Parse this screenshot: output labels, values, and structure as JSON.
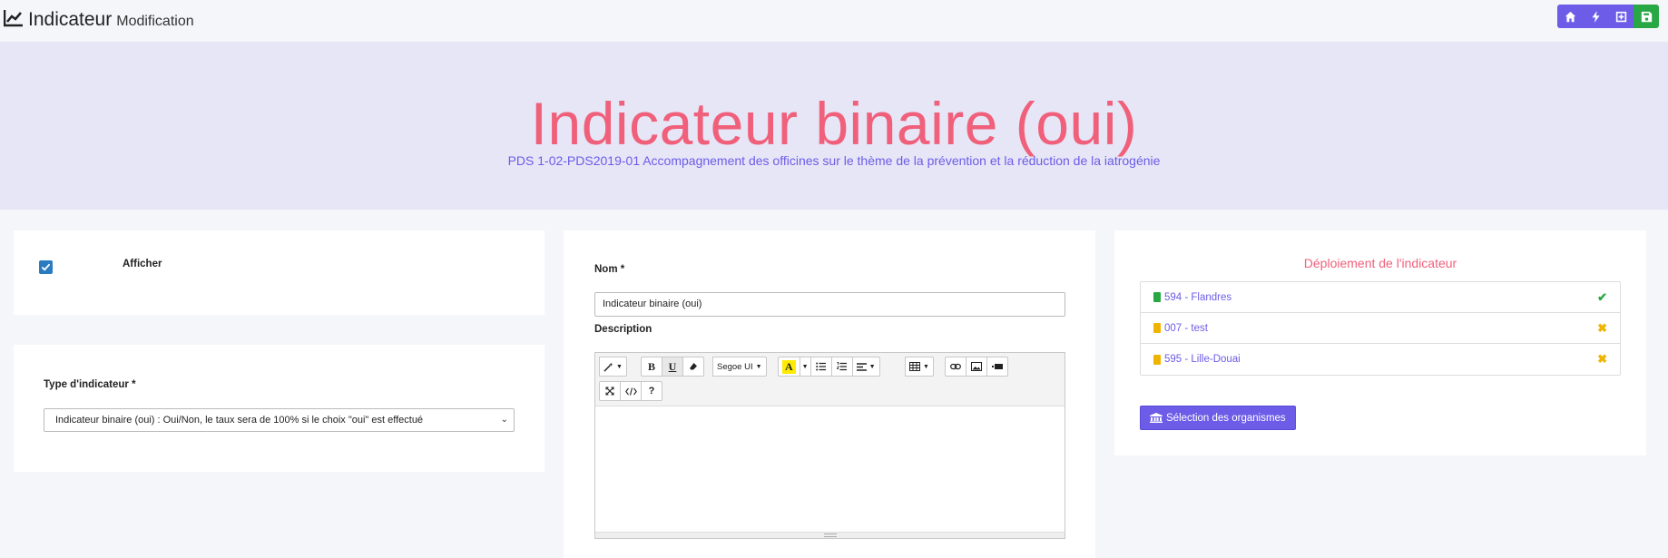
{
  "header": {
    "title": "Indicateur",
    "subtitle": "Modification",
    "actions": [
      {
        "icon": "home-icon"
      },
      {
        "icon": "bolt-icon"
      },
      {
        "icon": "plus-square-icon"
      },
      {
        "icon": "save-icon"
      }
    ]
  },
  "hero": {
    "title": "Indicateur binaire (oui)",
    "subtitle": "PDS 1-02-PDS2019-01 Accompagnement des officines sur le thème de la prévention et la réduction de la iatrogénie"
  },
  "display_card": {
    "checked": true,
    "label": "Afficher"
  },
  "type_card": {
    "label": "Type d'indicateur *",
    "selected": "Indicateur binaire (oui) : Oui/Non, le taux sera de 100% si le choix \"oui\" est effectué"
  },
  "form": {
    "nom_label": "Nom *",
    "nom_value": "Indicateur binaire (oui)",
    "description_label": "Description",
    "editor": {
      "font_name": "Segoe UI",
      "highlight_letter": "A",
      "bold": "B",
      "underline": "U",
      "help": "?"
    }
  },
  "deployment": {
    "title": "Déploiement de l'indicateur",
    "items": [
      {
        "label": "594 - Flandres",
        "status": "✔",
        "status_color": "#28a745",
        "icon_color": "#28a745"
      },
      {
        "label": "007 - test",
        "status": "✖",
        "status_color": "#f0b400",
        "icon_color": "#f0b400"
      },
      {
        "label": "595 - Lille-Douai",
        "status": "✖",
        "status_color": "#f0b400",
        "icon_color": "#f0b400"
      }
    ],
    "button_label": "Sélection des organismes"
  },
  "colors": {
    "accent": "#6c5ce7",
    "title_pink": "#f0607b",
    "hero_bg": "#e6e6f7",
    "success": "#28a745",
    "warning": "#f0b400"
  }
}
